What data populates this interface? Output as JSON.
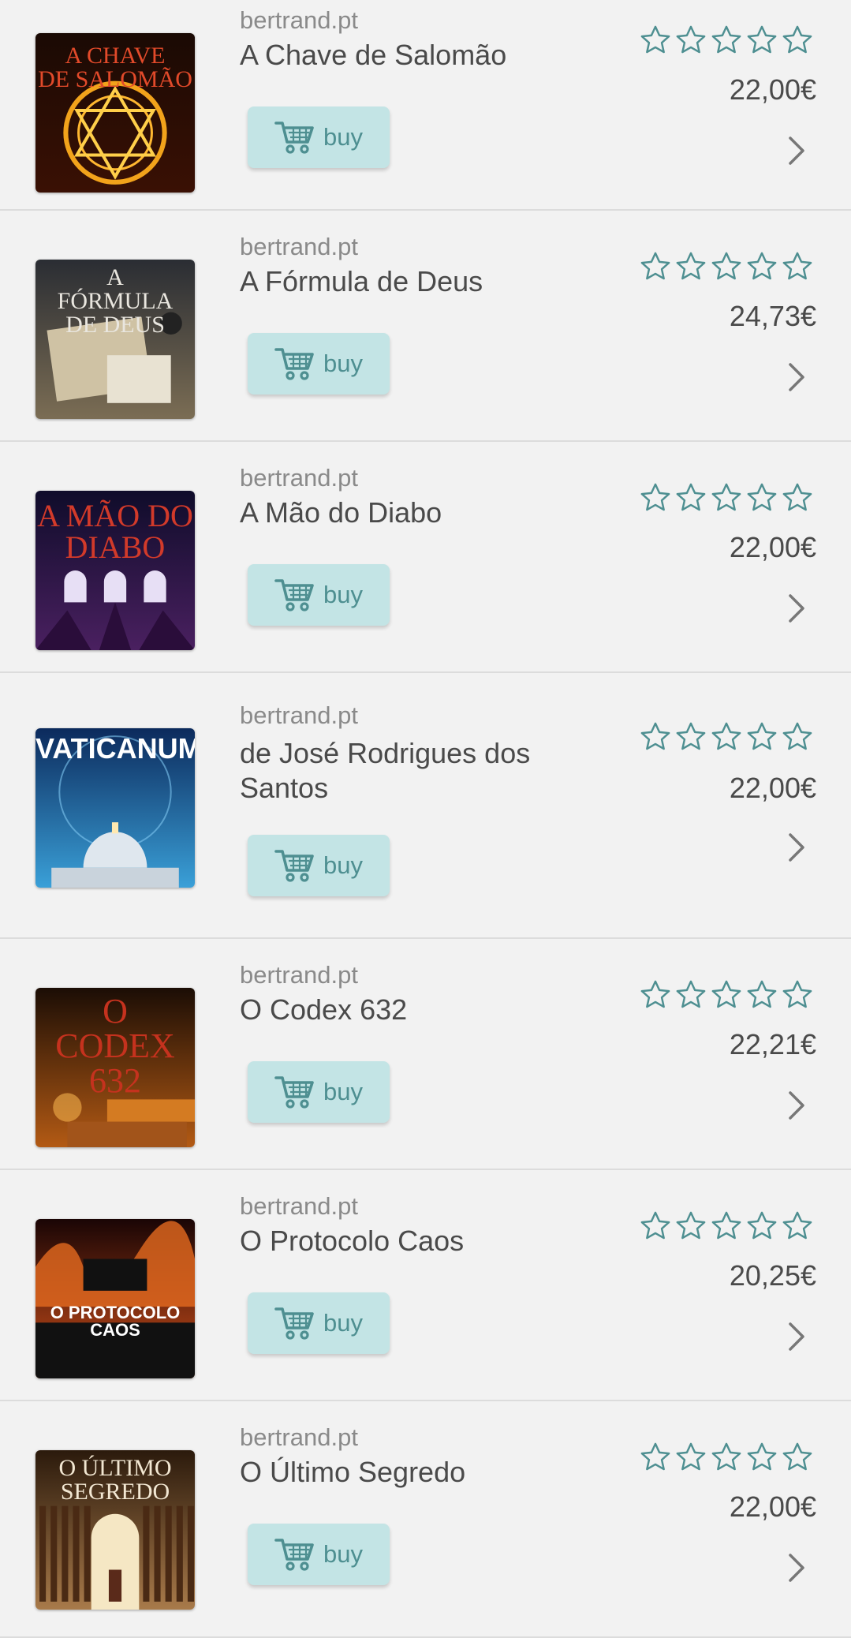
{
  "colors": {
    "accent": "#4e8f91",
    "buy_bg": "#c3e4e5",
    "row_bg": "#f2f2f2",
    "divider": "#dcdcdc"
  },
  "icons": {
    "cart": "cart-icon",
    "star": "star-outline-icon",
    "chevron": "chevron-right-icon"
  },
  "books": [
    {
      "source": "bertrand.pt",
      "title": "A Chave de Salomão",
      "price": "22,00€",
      "buy_label": "buy",
      "rating": 0,
      "cover_text": "A CHAVE\nDE SALOMÃO"
    },
    {
      "source": "bertrand.pt",
      "title": "A Fórmula de Deus",
      "price": "24,73€",
      "buy_label": "buy",
      "rating": 0,
      "cover_text": "A\nFÓRMULA\nDE DEUS"
    },
    {
      "source": "bertrand.pt",
      "title": "A Mão do Diabo",
      "price": "22,00€",
      "buy_label": "buy",
      "rating": 0,
      "cover_text": "A MÃO DO\nDIABO"
    },
    {
      "source": "bertrand.pt",
      "title": "de José Rodrigues dos Santos",
      "price": "22,00€",
      "buy_label": "buy",
      "rating": 0,
      "cover_text": "VATICANUM"
    },
    {
      "source": "bertrand.pt",
      "title": "O Codex 632",
      "price": "22,21€",
      "buy_label": "buy",
      "rating": 0,
      "cover_text": "O\nCODEX\n632"
    },
    {
      "source": "bertrand.pt",
      "title": "O Protocolo Caos",
      "price": "20,25€",
      "buy_label": "buy",
      "rating": 0,
      "cover_text": "O PROTOCOLO\nCAOS"
    },
    {
      "source": "bertrand.pt",
      "title": "O Último Segredo",
      "price": "22,00€",
      "buy_label": "buy",
      "rating": 0,
      "cover_text": "O ÚLTIMO\nSEGREDO"
    }
  ]
}
